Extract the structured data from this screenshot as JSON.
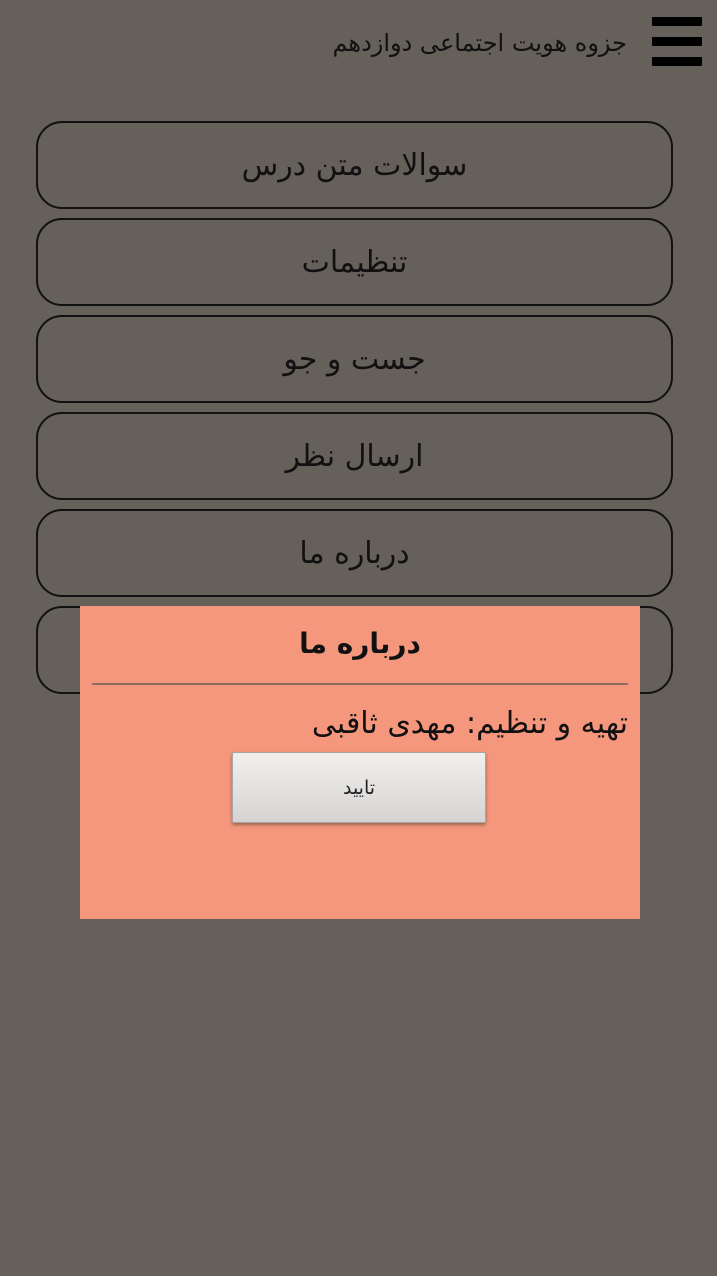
{
  "colors": {
    "background": "#656059",
    "dialog_background": "#f4977c",
    "text": "#111111",
    "button_gradient_top": "#f1f0ef",
    "button_gradient_bottom": "#d6d4d2"
  },
  "header": {
    "title": "جزوه هویت اجتماعی دوازدهم",
    "menu_icon": "hamburger-menu-icon"
  },
  "menu": {
    "items": [
      {
        "label": "سوالات متن درس"
      },
      {
        "label": "تنظیمات"
      },
      {
        "label": "جست و جو"
      },
      {
        "label": "ارسال نظر"
      },
      {
        "label": "درباره ما"
      },
      {
        "label": ""
      }
    ]
  },
  "dialog": {
    "title": "درباره ما",
    "message": "تهیه و تنظیم: مهدی ثاقبی",
    "confirm_label": "تایید"
  }
}
